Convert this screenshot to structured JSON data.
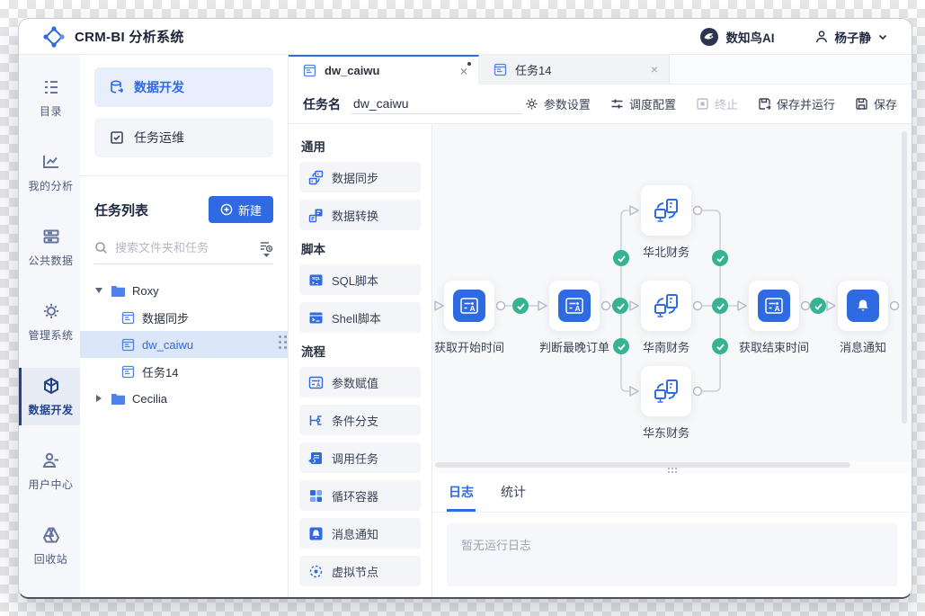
{
  "accents": {
    "primary_blue": "#2E6AE1",
    "navy": "#24418C",
    "success_green": "#35B392"
  },
  "header": {
    "title": "CRM-BI 分析系统",
    "ai_label": "数知鸟AI",
    "user_name": "杨子静"
  },
  "rail": {
    "items": [
      {
        "label": "目录"
      },
      {
        "label": "我的分析"
      },
      {
        "label": "公共数据"
      },
      {
        "label": "管理系统"
      },
      {
        "label": "数据开发"
      },
      {
        "label": "用户中心"
      },
      {
        "label": "回收站"
      }
    ]
  },
  "explorer": {
    "nav": [
      {
        "label": "数据开发"
      },
      {
        "label": "任务运维"
      }
    ],
    "list_title": "任务列表",
    "new_button": "新建",
    "search_placeholder": "搜索文件夹和任务",
    "tree": [
      {
        "label": "Roxy",
        "type": "folder",
        "state": "expanded"
      },
      {
        "label": "数据同步",
        "type": "task"
      },
      {
        "label": "dw_caiwu",
        "type": "task",
        "selected": true
      },
      {
        "label": "任务14",
        "type": "task"
      },
      {
        "label": "Cecilia",
        "type": "folder",
        "state": "collapsed"
      }
    ]
  },
  "tabs": [
    {
      "label": "dw_caiwu",
      "active": true,
      "dirty": true
    },
    {
      "label": "任务14",
      "active": false
    }
  ],
  "taskbar": {
    "name_label": "任务名",
    "name_value": "dw_caiwu",
    "actions": [
      {
        "label": "参数设置"
      },
      {
        "label": "调度配置"
      },
      {
        "label": "终止",
        "disabled": true
      },
      {
        "label": "保存并运行"
      },
      {
        "label": "保存"
      }
    ]
  },
  "tools": {
    "sections": [
      {
        "title": "通用",
        "items": [
          {
            "label": "数据同步"
          },
          {
            "label": "数据转换"
          }
        ]
      },
      {
        "title": "脚本",
        "items": [
          {
            "label": "SQL脚本"
          },
          {
            "label": "Shell脚本"
          }
        ]
      },
      {
        "title": "流程",
        "items": [
          {
            "label": "参数赋值"
          },
          {
            "label": "条件分支"
          },
          {
            "label": "调用任务"
          },
          {
            "label": "循环容器"
          },
          {
            "label": "消息通知"
          },
          {
            "label": "虚拟节点"
          }
        ]
      }
    ]
  },
  "flow": {
    "nodes": [
      {
        "label": "获取开始时间",
        "type": "param",
        "status": "success"
      },
      {
        "label": "判断最晚订单",
        "type": "param",
        "status": "success"
      },
      {
        "label": "华北财务",
        "type": "sync",
        "status": "success"
      },
      {
        "label": "华南财务",
        "type": "sync",
        "status": "success"
      },
      {
        "label": "华东财务",
        "type": "sync",
        "status": "success"
      },
      {
        "label": "获取结束时间",
        "type": "param",
        "status": "success"
      },
      {
        "label": "消息通知",
        "type": "notify",
        "status": "success"
      }
    ]
  },
  "logpanel": {
    "tabs": [
      {
        "label": "日志",
        "active": true
      },
      {
        "label": "统计",
        "active": false
      }
    ],
    "empty_text": "暂无运行日志"
  }
}
